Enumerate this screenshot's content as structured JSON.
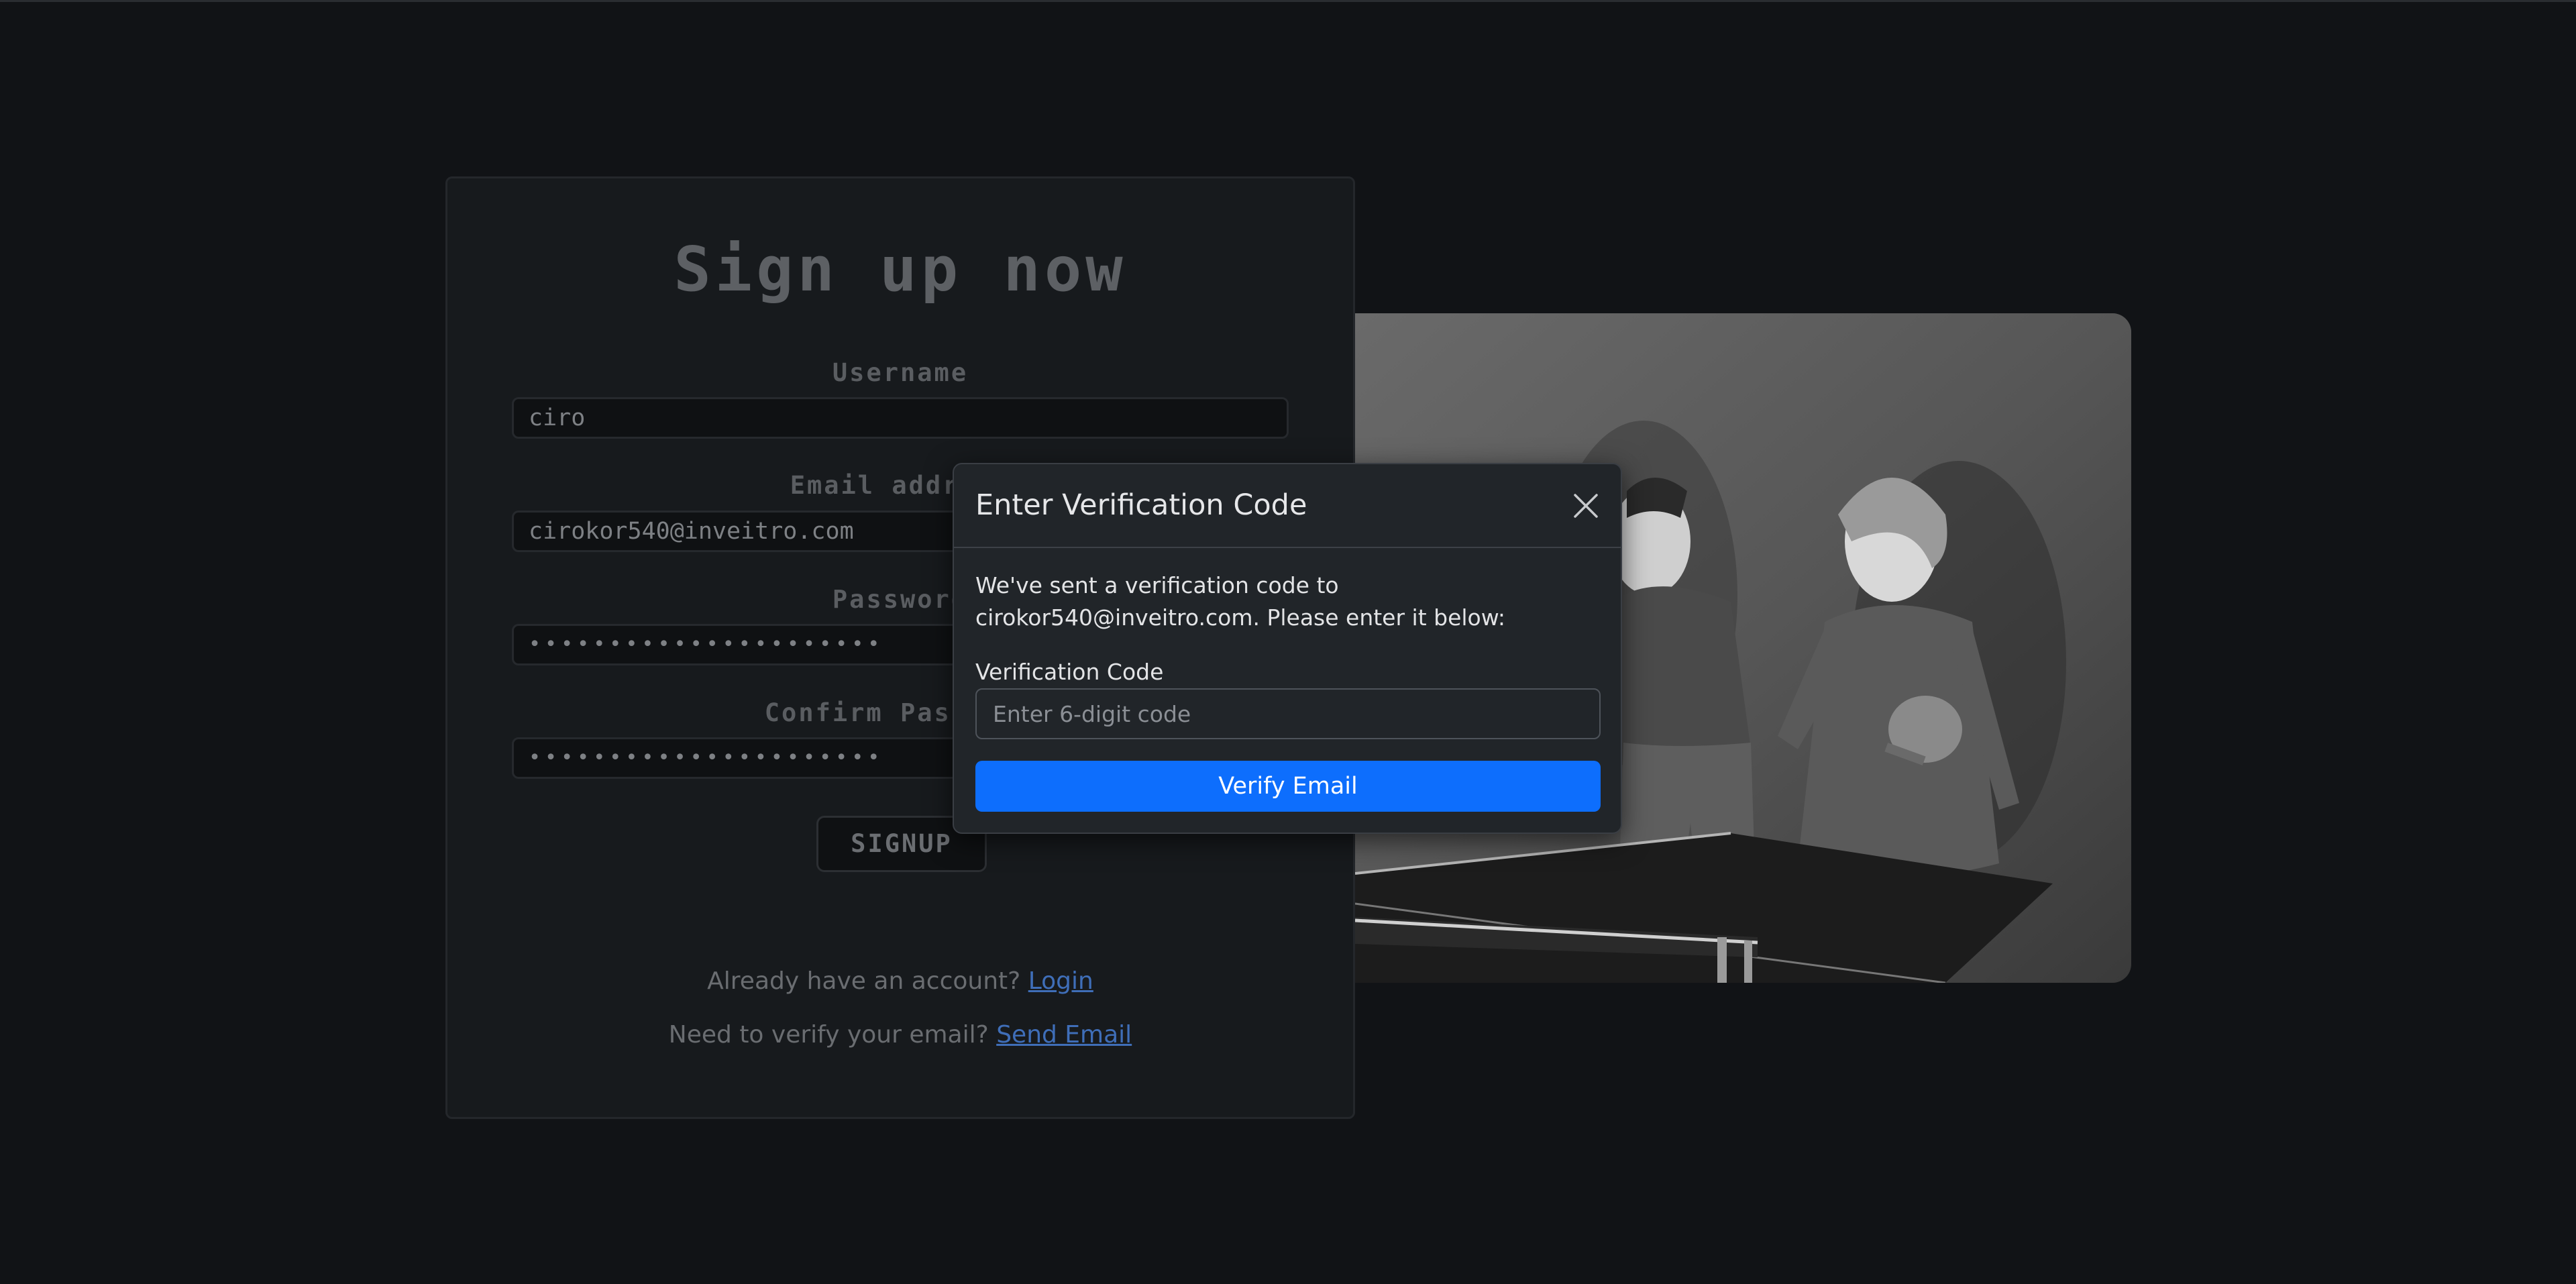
{
  "signup": {
    "title": "Sign up now",
    "username_label": "Username",
    "username_value": "ciro",
    "email_label": "Email address",
    "email_value": "cirokor540@inveitro.com",
    "password_label": "Password",
    "password_value": "••••••••••••••••••••••",
    "confirm_label": "Confirm Password",
    "confirm_value": "••••••••••••••••••••••",
    "signup_button": "SIGNUP",
    "login_prompt": "Already have an account?",
    "login_link": "Login",
    "verify_prompt": "Need to verify your email?",
    "verify_link": "Send Email"
  },
  "modal": {
    "title": "Enter Verification Code",
    "message": "We've sent a verification code to cirokor540@inveitro.com. Please enter it below:",
    "code_label": "Verification Code",
    "code_placeholder": "Enter 6-digit code",
    "verify_button": "Verify Email"
  },
  "colors": {
    "accent": "#0d6efd",
    "background": "#111316",
    "link": "#3f6eb8"
  }
}
